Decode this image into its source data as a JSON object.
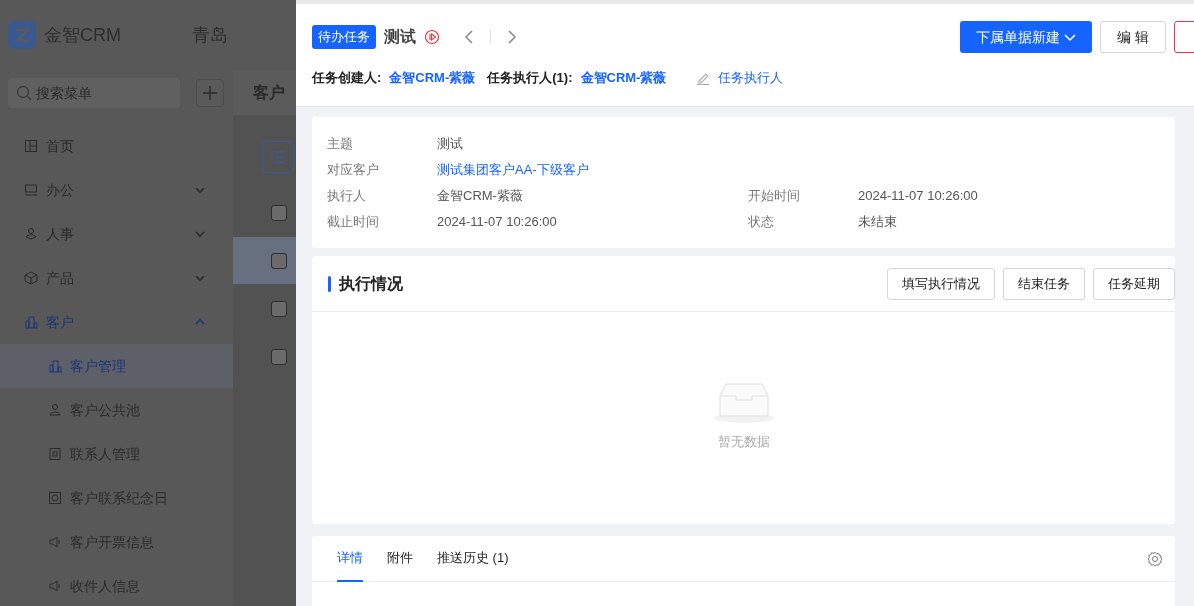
{
  "app": {
    "brand": "金智CRM",
    "company": "青岛",
    "search": {
      "placeholder": "搜索菜单"
    },
    "menu": [
      {
        "label": "首页",
        "kind": "link",
        "selected": false
      },
      {
        "label": "办公",
        "kind": "group",
        "expanded": false,
        "selected": false
      },
      {
        "label": "人事",
        "kind": "group",
        "expanded": false,
        "selected": false
      },
      {
        "label": "产品",
        "kind": "group",
        "expanded": false,
        "selected": false
      },
      {
        "label": "客户",
        "kind": "group",
        "expanded": true,
        "selected": true,
        "children": [
          {
            "label": "客户管理",
            "selected": true
          },
          {
            "label": "客户公共池",
            "selected": false
          },
          {
            "label": "联系人管理",
            "selected": false
          },
          {
            "label": "客户联系纪念日",
            "selected": false
          },
          {
            "label": "客户开票信息",
            "selected": false
          },
          {
            "label": "收件人信息",
            "selected": false
          }
        ]
      }
    ],
    "page_title": "客户",
    "rows": [
      {
        "checked": false,
        "selected": false
      },
      {
        "checked": false,
        "selected": true
      },
      {
        "checked": false,
        "selected": false
      },
      {
        "checked": false,
        "selected": false
      }
    ]
  },
  "drawer": {
    "tag": "待办任务",
    "title": "测试",
    "buttons": [
      {
        "label": "下属单据新建",
        "kind": "dropdown"
      },
      {
        "label": "编 辑",
        "kind": "default"
      },
      {
        "kind": "danger"
      }
    ],
    "creator_label": "任务创建人:",
    "creator": "金智CRM-紫薇",
    "executor_label": "任务执行人(1):",
    "executor": "金智CRM-紫薇",
    "assign_link": "任务执行人",
    "fields": [
      [
        {
          "label": "主题",
          "value": "测试",
          "kind": "text"
        }
      ],
      [
        {
          "label": "对应客户",
          "value": "测试集团客户AA-下级客户",
          "kind": "link"
        }
      ],
      [
        {
          "label": "执行人",
          "value": "金智CRM-紫薇",
          "kind": "text"
        },
        {
          "label": "开始时间",
          "value": "2024-11-07 10:26:00",
          "kind": "text"
        }
      ],
      [
        {
          "label": "截止时间",
          "value": "2024-11-07 10:26:00",
          "kind": "text"
        },
        {
          "label": "状态",
          "value": "未结束",
          "kind": "text"
        }
      ]
    ],
    "execution": {
      "title": "执行情况",
      "actions": [
        "填写执行情况",
        "结束任务",
        "任务延期"
      ],
      "empty_text": "暂无数据"
    },
    "tabs": [
      {
        "label": "详情",
        "selected": true
      },
      {
        "label": "附件",
        "selected": false
      },
      {
        "label": "推送历史 (1)",
        "selected": false
      }
    ]
  }
}
